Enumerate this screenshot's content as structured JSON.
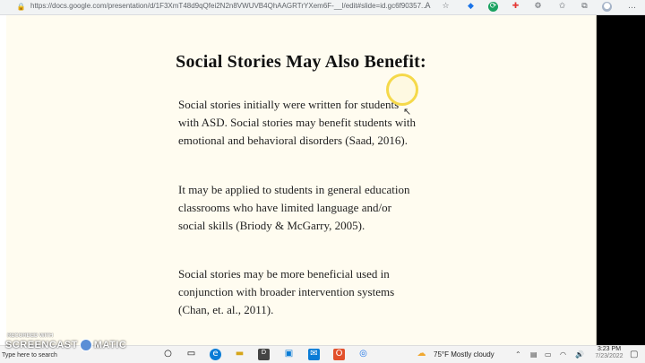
{
  "browser": {
    "url": "https://docs.google.com/presentation/d/1F3XmT48d9qQfei2N2n8VWUVB4QhAAGRTrYXem6F-__l/edit#slide=id.gc6f90357...",
    "lock_icon": "lock-icon",
    "icons": [
      "read-aloud-icon",
      "favorite-icon",
      "extension-icon",
      "extension-icon",
      "extension-icon",
      "extension-icon",
      "favorites-icon",
      "collections-icon",
      "profile-avatar",
      "more-icon"
    ]
  },
  "slide": {
    "title": "Social Stories May Also Benefit:",
    "paragraphs": [
      "Social stories initially were written for students with ASD. Social stories may benefit students with emotional and behavioral disorders (Saad, 2016).",
      "It may be applied to students in general education classrooms who have limited language and/or social skills (Briody & McGarry, 2005).",
      "Social stories may be more beneficial used in conjunction with broader intervention systems (Chan, et. al., 2011)."
    ]
  },
  "watermark": {
    "recorded": "RECORDED WITH",
    "brand_left": "SCREENCAST",
    "brand_right": "MATIC"
  },
  "taskbar": {
    "search_placeholder": "Type here to search",
    "weather": "75°F  Mostly cloudy",
    "time": "3:23 PM",
    "date": "7/23/2022"
  }
}
